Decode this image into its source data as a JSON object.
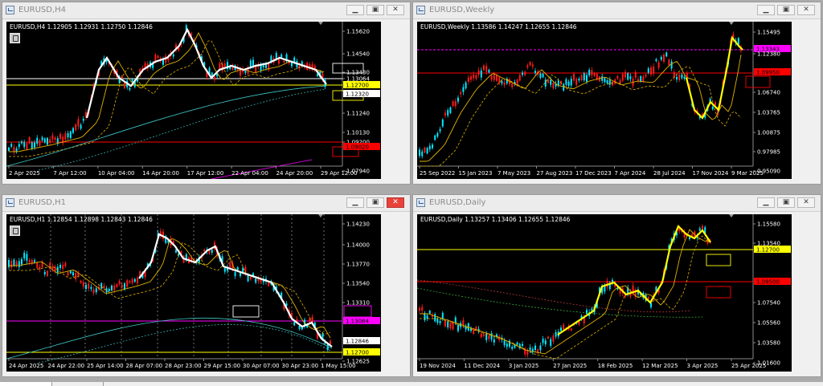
{
  "windows": [
    {
      "key": "w1",
      "title": "EURUSD,H4",
      "header": "EURUSD,H4  1.12905 1.12931 1.12750 1.12846",
      "price_labels": [
        "1.15620",
        "1.14540",
        "1.13430",
        "1.13064",
        "1.12700",
        "1.12320",
        "1.11240",
        "1.10130",
        "1.09200",
        "1.09020",
        "1.07940"
      ],
      "time_labels": [
        "2 Apr 2025",
        "7 Apr 12:00",
        "10 Apr 04:00",
        "14 Apr 20:00",
        "17 Apr 12:00",
        "22 Apr 04:00",
        "24 Apr 20:00",
        "29 Apr 12:00"
      ],
      "close_active": false
    },
    {
      "key": "w2",
      "title": "EURUSD,Weekly",
      "header": "EURUSD,Weekly  1.13586 1.14247 1.12655 1.12846",
      "price_labels": [
        "1.15495",
        "1.13343",
        "1.12380",
        "1.09950",
        "1.06740",
        "1.03765",
        "1.00875",
        "0.97985",
        "0.95090"
      ],
      "time_labels": [
        "25 Sep 2022",
        "15 Jan 2023",
        "7 May 2023",
        "27 Aug 2023",
        "17 Dec 2023",
        "7 Apr 2024",
        "28 Jul 2024",
        "17 Nov 2024",
        "9 Mar 2025"
      ],
      "close_active": false
    },
    {
      "key": "w3",
      "title": "EURUSD,H1",
      "header": "EURUSD,H1  1.12854 1.12898 1.12843 1.12846",
      "price_labels": [
        "1.14230",
        "1.14000",
        "1.13770",
        "1.13540",
        "1.13310",
        "1.13084",
        "1.12846",
        "1.12700",
        "1.12625"
      ],
      "time_labels": [
        "24 Apr 2025",
        "24 Apr 22:00",
        "25 Apr 14:00",
        "28 Apr 07:00",
        "28 Apr 23:00",
        "29 Apr 15:00",
        "30 Apr 07:00",
        "30 Apr 23:00",
        "1 May 15:00"
      ],
      "close_active": true
    },
    {
      "key": "w4",
      "title": "EURUSD,Daily",
      "header": "EURUSD,Daily  1.13257 1.13406 1.12655 1.12846",
      "price_labels": [
        "1.15580",
        "1.13540",
        "1.12700",
        "1.09500",
        "1.07540",
        "1.05560",
        "1.03580",
        "1.01600"
      ],
      "time_labels": [
        "19 Nov 2024",
        "11 Dec 2024",
        "3 Jan 2025",
        "27 Jan 2025",
        "18 Feb 2025",
        "12 Mar 2025",
        "3 Apr 2025",
        "25 Apr 2025"
      ],
      "close_active": false
    }
  ],
  "buttons": {
    "minimize": "▁",
    "restore": "▣",
    "close": "✕"
  },
  "colors": {
    "background": "#000000",
    "bull_candle": "#00e8ff",
    "bear_candle": "#ff1a1a",
    "zigzag_white": "#ffffff",
    "zigzag_yellow": "#ffff00",
    "support_line": "#ffff00",
    "resistance_line": "#ff0000",
    "magenta_line": "#ff00ff",
    "ma_gold": "#e0b000"
  },
  "icons": [
    "chart-window-icon",
    "expert-advisor-icon",
    "minimize-icon",
    "restore-icon",
    "close-icon"
  ]
}
